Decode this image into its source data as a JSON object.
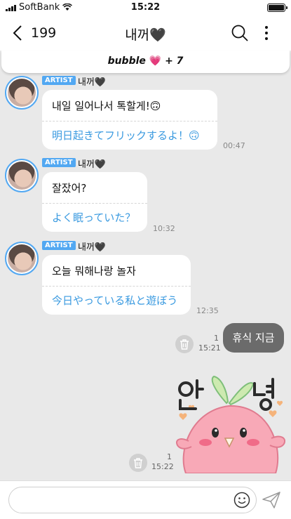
{
  "status_bar": {
    "carrier": "SoftBank",
    "time": "15:22"
  },
  "header": {
    "back_count": "199",
    "title": "내꺼🖤"
  },
  "banner": {
    "text": "bubble",
    "heart": "💗",
    "extra": "+ 7"
  },
  "messages": [
    {
      "badge": "ARTIST",
      "name": "내꺼🖤",
      "ko": "내일 일어나서 톡할게!🙃",
      "ja": "明日起きてフリックするよ！🙃",
      "time": "00:47"
    },
    {
      "badge": "ARTIST",
      "name": "내꺼🖤",
      "ko": "잘잤어?",
      "ja": "よく眠っていた？",
      "time": "10:32"
    },
    {
      "badge": "ARTIST",
      "name": "내꺼🖤",
      "ko": "오늘 뭐해나랑 놀자",
      "ja": "今日やっている私と遊ぼう",
      "time": "12:35"
    }
  ],
  "sent": [
    {
      "text": "휴식 지금",
      "read": "1",
      "time": "15:21"
    },
    {
      "sticker": "안녕",
      "read": "1",
      "time": "15:22"
    }
  ],
  "input": {
    "value": "",
    "placeholder": ""
  },
  "colors": {
    "accent": "#52a8f2",
    "translation": "#3a9ae0",
    "sent_bubble": "#6b6b6b",
    "heart": "#e8459a"
  }
}
